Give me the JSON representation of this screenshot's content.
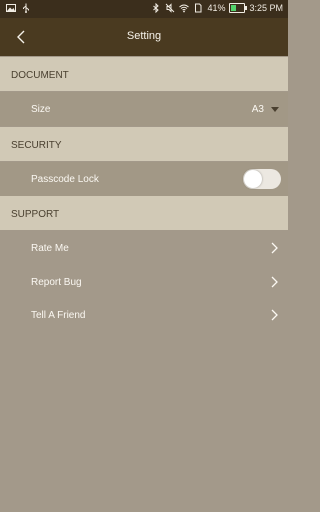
{
  "status_bar": {
    "battery_percent": "41%",
    "time": "3:25 PM",
    "battery_level": 0.41,
    "icons": [
      "image-icon",
      "usb-icon",
      "bluetooth-icon",
      "mute-icon",
      "wifi-icon",
      "sim-icon",
      "battery-icon"
    ]
  },
  "app_bar": {
    "title": "Setting",
    "back_icon": "back-arrow-icon"
  },
  "sections": {
    "document": {
      "header": "DOCUMENT",
      "size_label": "Size",
      "size_value": "A3"
    },
    "security": {
      "header": "SECURITY",
      "passcode_label": "Passcode Lock",
      "passcode_enabled": false
    },
    "support": {
      "header": "SUPPORT",
      "rate_label": "Rate Me",
      "bug_label": "Report Bug",
      "friend_label": "Tell A Friend"
    }
  },
  "colors": {
    "status_bar": "#3b2e1c",
    "app_bar": "#4a3a20",
    "section_header": "#d1c9b6",
    "background": "#a3998a",
    "battery_fill": "#53d36b"
  }
}
